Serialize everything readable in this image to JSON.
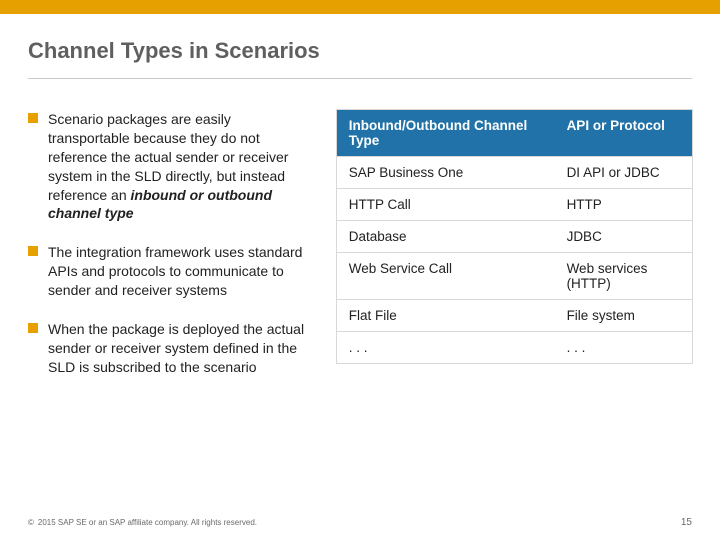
{
  "colors": {
    "accent_gold": "#e6a100",
    "table_header_blue": "#2072a8"
  },
  "title": "Channel Types in Scenarios",
  "bullets": [
    {
      "plain": "Scenario packages are easily transportable because they do not reference the actual sender or receiver system in the SLD directly, but instead reference an ",
      "emph": "inbound or outbound channel type"
    },
    {
      "plain": "The integration framework uses standard APIs and protocols to communicate to sender and receiver systems",
      "emph": ""
    },
    {
      "plain": "When the package is deployed the actual sender or receiver system defined in the SLD is subscribed to the scenario",
      "emph": ""
    }
  ],
  "table": {
    "headers": [
      "Inbound/Outbound Channel Type",
      "API or Protocol"
    ],
    "rows": [
      [
        "SAP Business One",
        "DI API or JDBC"
      ],
      [
        "HTTP Call",
        "HTTP"
      ],
      [
        "Database",
        "JDBC"
      ],
      [
        "Web Service Call",
        "Web services (HTTP)"
      ],
      [
        "Flat File",
        "File system"
      ],
      [
        ". . .",
        ". . ."
      ]
    ]
  },
  "footer": {
    "copyright_symbol": "©",
    "copyright_text": "2015 SAP SE or an SAP affiliate company. All rights reserved.",
    "page_number": "15"
  }
}
